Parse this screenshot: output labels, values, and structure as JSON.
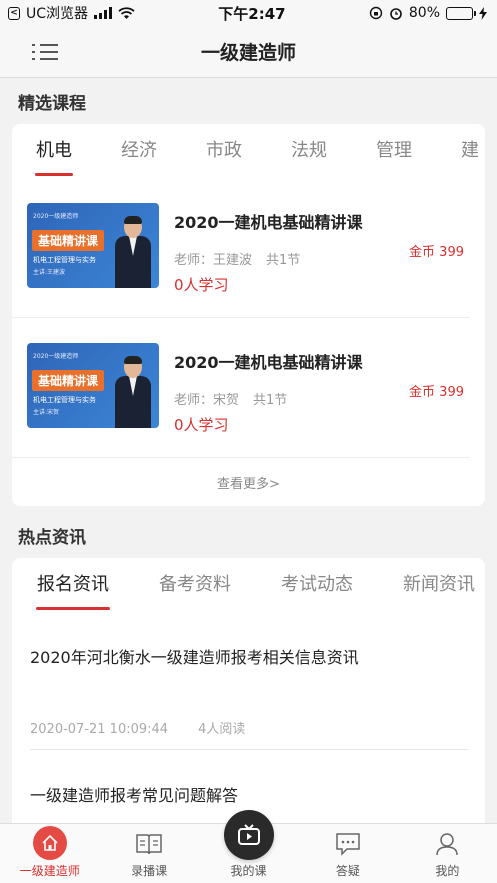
{
  "status_bar": {
    "back_app": "UC浏览器",
    "time": "下午2:47",
    "battery": "80%",
    "battery_level": 0.8
  },
  "nav": {
    "title": "一级建造师"
  },
  "featured": {
    "heading": "精选课程",
    "tabs": [
      "机电",
      "经济",
      "市政",
      "法规",
      "管理",
      "建"
    ],
    "courses": [
      {
        "thumb_top": "2020一级建造师",
        "thumb_badge": "基础精讲课",
        "thumb_subject": "机电工程管理与实务",
        "thumb_speaker": "主讲:王建波",
        "title": "2020一建机电基础精讲课",
        "teacher": "老师：王建波",
        "lessons": "共1节",
        "learners": "0人学习",
        "price": "金币 399"
      },
      {
        "thumb_top": "2020一级建造师",
        "thumb_badge": "基础精讲课",
        "thumb_subject": "机电工程管理与实务",
        "thumb_speaker": "主讲:宋贺",
        "title": "2020一建机电基础精讲课",
        "teacher": "老师：宋贺",
        "lessons": "共1节",
        "learners": "0人学习",
        "price": "金币 399"
      }
    ],
    "more": "查看更多>"
  },
  "news": {
    "heading": "热点资讯",
    "tabs": [
      "报名资讯",
      "备考资料",
      "考试动态",
      "新闻资讯"
    ],
    "items": [
      {
        "title": "2020年河北衡水一级建造师报考相关信息资讯",
        "date": "2020-07-21 10:09:44",
        "reads": "4人阅读"
      },
      {
        "title": "一级建造师报考常见问题解答"
      }
    ]
  },
  "tabbar": {
    "items": [
      {
        "label": "一级建造师",
        "icon": "home-icon"
      },
      {
        "label": "录播课",
        "icon": "book-icon"
      },
      {
        "label": "我的课",
        "icon": "video-icon"
      },
      {
        "label": "答疑",
        "icon": "chat-icon"
      },
      {
        "label": "我的",
        "icon": "user-icon"
      }
    ]
  },
  "colors": {
    "accent": "#d8302f",
    "background": "#f2f2f2"
  }
}
